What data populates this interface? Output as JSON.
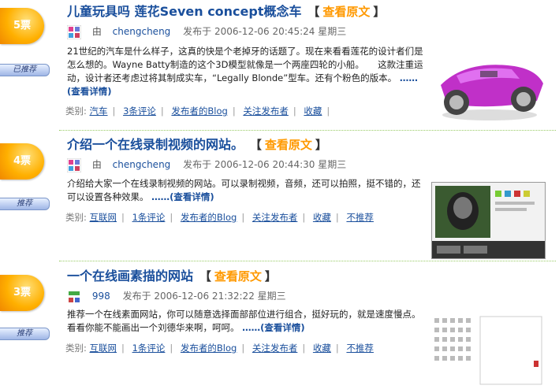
{
  "stories": [
    {
      "votes": "5票",
      "tab": "已推荐",
      "title": "儿童玩具吗 莲花Seven concept概念车",
      "view_original": "查看原文",
      "by": "由",
      "author": "chengcheng",
      "published": "发布于 2006-12-06 20:45:24 星期三",
      "summary": "21世纪的汽车是什么样子，这真的快是个老掉牙的话题了。现在来看看莲花的设计者们是怎么想的。Wayne Batty制造的这个3D模型就像是一个两座四轮的小船。　　这款注重运动，设计者还考虑过将其制成实车，“Legally Blonde”型车。还有个粉色的版本。",
      "detail_link": "……(查看详情)",
      "actions": {
        "category_label": "类别:",
        "category": "汽车",
        "comments": "3条评论",
        "blog": "发布者的Blog",
        "follow": "关注发布者",
        "favorite": "收藏"
      }
    },
    {
      "votes": "4票",
      "tab": "推荐",
      "title": "介绍一个在线录制视频的网站。",
      "view_original": "查看原文",
      "by": "由",
      "author": "chengcheng",
      "published": "发布于 2006-12-06 20:44:30 星期三",
      "summary": "介绍给大家一个在线录制视频的网站。可以录制视频，音频，还可以拍照，挺不错的，还可以设置各种效果。",
      "detail_link": "……(查看详情)",
      "actions": {
        "category_label": "类别:",
        "category": "互联网",
        "comments": "1条评论",
        "blog": "发布者的Blog",
        "follow": "关注发布者",
        "favorite": "收藏",
        "not_recommend": "不推荐"
      }
    },
    {
      "votes": "3票",
      "tab": "推荐",
      "title": "一个在线画素描的网站",
      "view_original": "查看原文",
      "by": "由",
      "author": "998",
      "published": "发布于 2006-12-06 21:32:22 星期三",
      "summary": "推荐一个在线素面网站，你可以随意选择面部部位进行组合，挺好玩的，就是速度慢点。看看你能不能画出一个刘德华来啊，呵呵。",
      "detail_link": "……(查看详情)",
      "actions": {
        "category_label": "类别:",
        "category": "互联网",
        "comments": "1条评论",
        "blog": "发布者的Blog",
        "follow": "关注发布者",
        "favorite": "收藏",
        "not_recommend": "不推荐"
      }
    }
  ],
  "colors": {
    "link": "#1a4f9c",
    "view_original": "#ff9900",
    "badge": "#ffb000",
    "separator": "#99cc66"
  }
}
